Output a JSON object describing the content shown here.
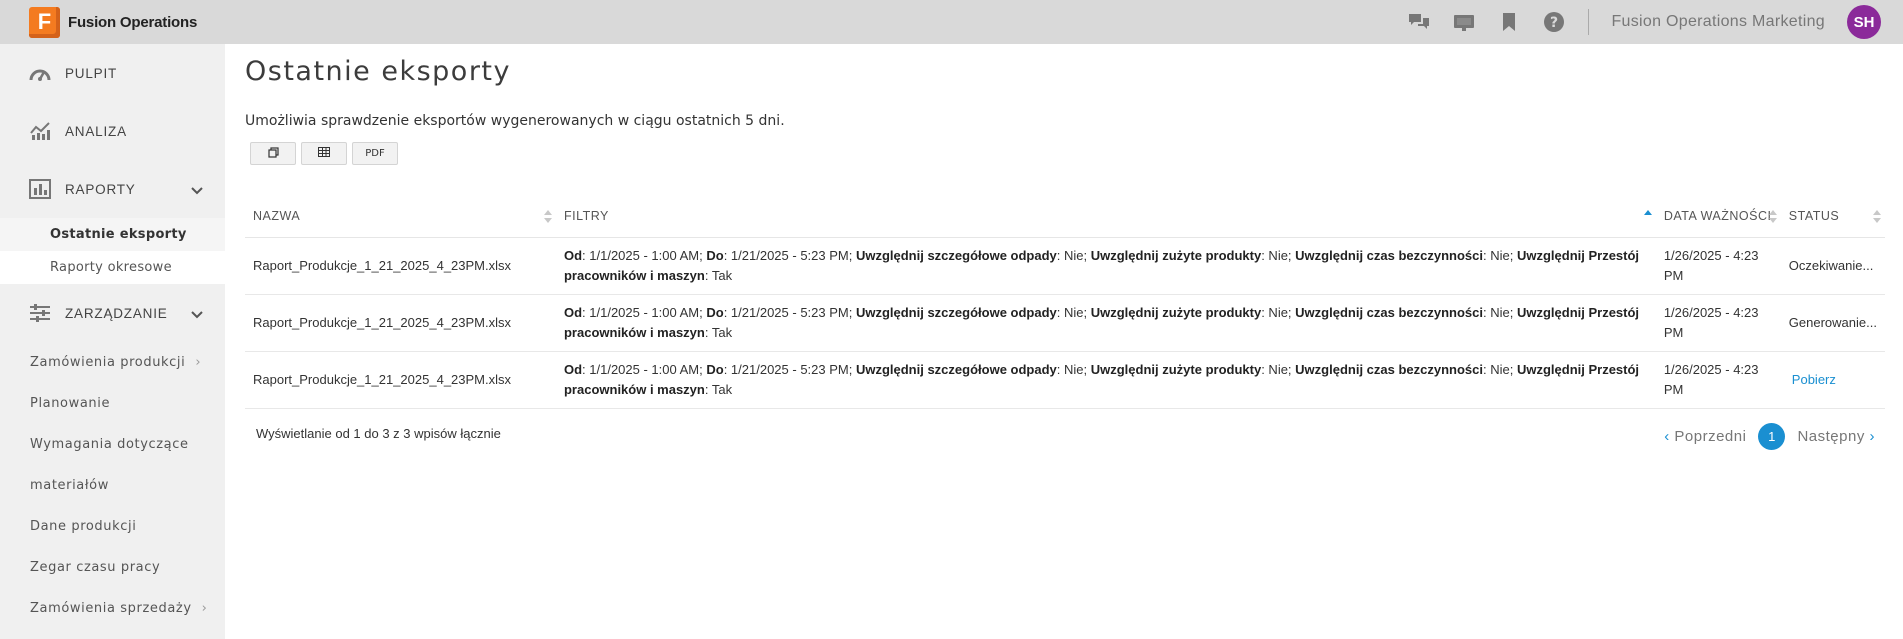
{
  "topbar": {
    "logo_letter": "F",
    "app_name": "Fusion Operations",
    "company": "Fusion Operations Marketing",
    "avatar_initials": "SH",
    "icons": [
      "chat-icon",
      "presentation-icon",
      "bookmark-icon",
      "help-icon"
    ]
  },
  "sidebar": {
    "main_items": [
      {
        "label": "PULPIT",
        "icon": "dashboard-icon"
      },
      {
        "label": "ANALIZA",
        "icon": "chart-icon"
      },
      {
        "label": "RAPORTY",
        "icon": "report-icon"
      }
    ],
    "reports_sub": [
      {
        "label": "Ostatnie eksporty",
        "active": true
      },
      {
        "label": "Raporty okresowe",
        "active": false
      }
    ],
    "management": {
      "label": "ZARZĄDZANIE",
      "icon": "sliders-icon"
    },
    "management_items": [
      {
        "label": "Zamówienia produkcji",
        "arrow": "›"
      },
      {
        "label": "Planowanie"
      },
      {
        "label": "Wymagania dotyczące"
      },
      {
        "label": "materiałów"
      },
      {
        "label": "Dane produkcji"
      },
      {
        "label": "Zegar czasu pracy"
      },
      {
        "label": "Zamówienia sprzedaży",
        "arrow": "›"
      }
    ]
  },
  "main": {
    "title": "Ostatnie eksporty",
    "description": "Umożliwia sprawdzenie eksportów wygenerowanych w ciągu ostatnich 5 dni.",
    "buttons": {
      "copy": "copy-icon",
      "excel": "table-icon",
      "pdf_label": "PDF"
    },
    "columns": [
      "NAZWA",
      "FILTRY",
      "DATA WAŻNOŚCI",
      "STATUS"
    ],
    "filters": {
      "od_key": "Od",
      "od_value": ": 1/1/2025 - 1:00 AM; ",
      "do_key": "Do",
      "do_value": ": 1/21/2025 - 5:23 PM; ",
      "k1": "Uwzględnij szczegółowe odpady",
      "v1": ": Nie; ",
      "k2": "Uwzględnij zużyte produkty",
      "v2": ": Nie; ",
      "k3": "Uwzględnij czas bezczynności",
      "v3": ": Nie; ",
      "k4": "Uwzględnij Przestój pracowników i maszyn",
      "v4": ": Tak"
    },
    "rows": [
      {
        "name": "Raport_Produkcje_1_21_2025_4_23PM.xlsx",
        "expiry": "1/26/2025 - 4:23 PM",
        "status": "Oczekiwanie..."
      },
      {
        "name": "Raport_Produkcje_1_21_2025_4_23PM.xlsx",
        "expiry": "1/26/2025 - 4:23 PM",
        "status": "Generowanie..."
      },
      {
        "name": "Raport_Produkcje_1_21_2025_4_23PM.xlsx",
        "expiry": "1/26/2025 - 4:23 PM",
        "status": "Pobierz"
      }
    ],
    "info": "Wyświetlanie od 1 do 3 z 3 wpisów łącznie",
    "pager": {
      "prev": "Poprzedni",
      "current": "1",
      "next": "Następny"
    }
  }
}
